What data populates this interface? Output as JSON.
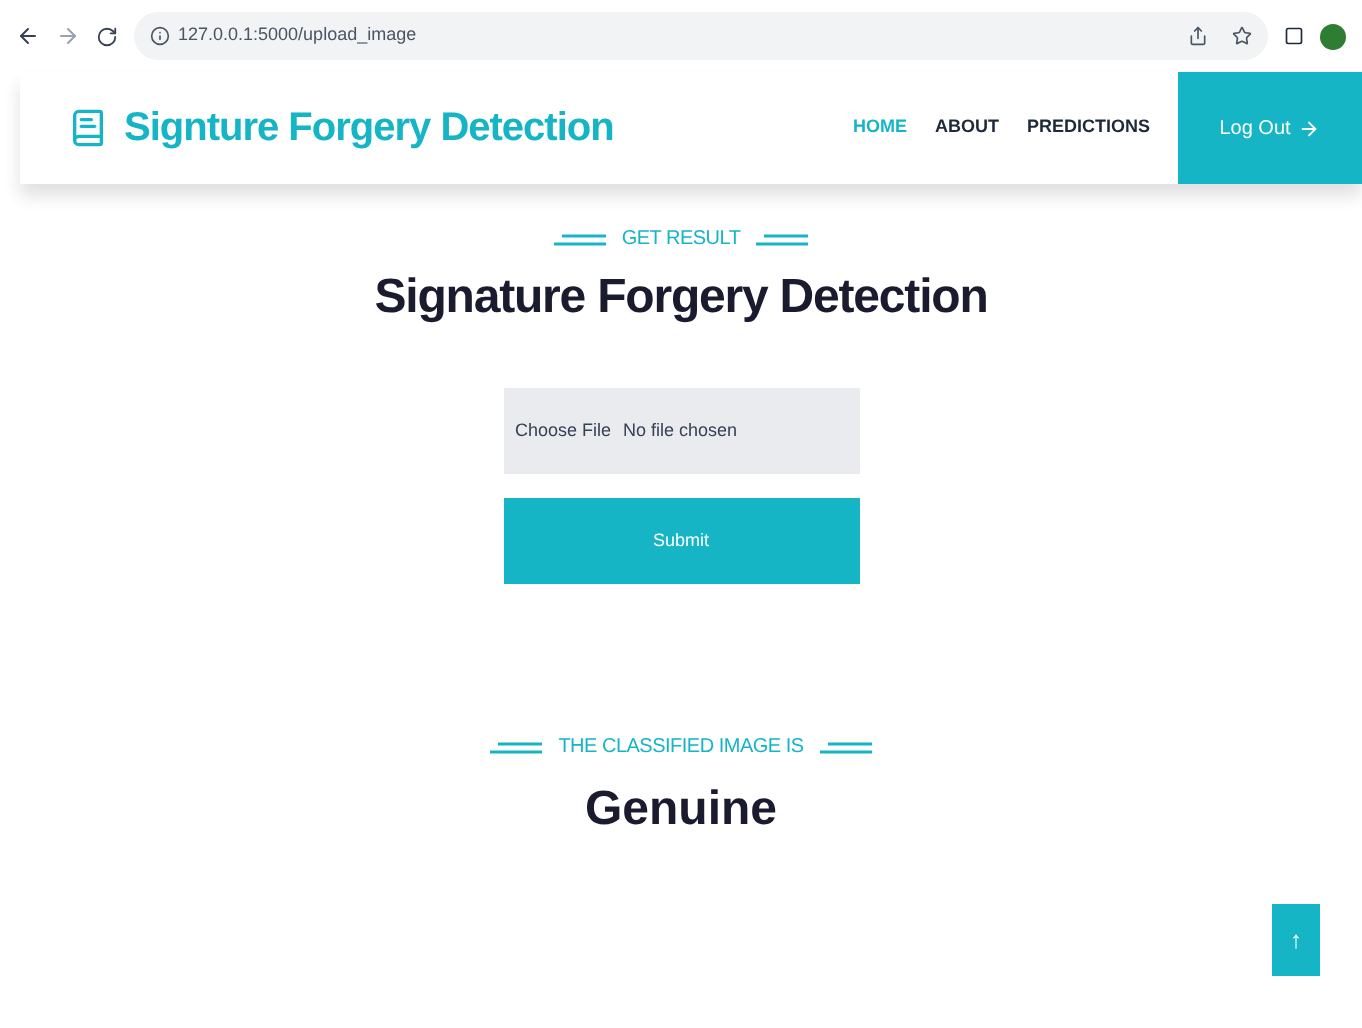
{
  "browser": {
    "url": "127.0.0.1:5000/upload_image"
  },
  "navbar": {
    "brand": "Signture Forgery Detection",
    "items": [
      {
        "label": "HOME",
        "selected": true
      },
      {
        "label": "ABOUT",
        "selected": false
      },
      {
        "label": "PREDICTIONS",
        "selected": false
      }
    ],
    "logout": "Log Out"
  },
  "upload": {
    "eyebrow": "GET RESULT",
    "title": "Signature Forgery Detection",
    "choose_button": "Choose File",
    "file_status": "No file chosen",
    "submit": "Submit"
  },
  "result": {
    "eyebrow": "THE CLASSIFIED IMAGE IS",
    "value": "Genuine"
  },
  "back_to_top": "↑"
}
